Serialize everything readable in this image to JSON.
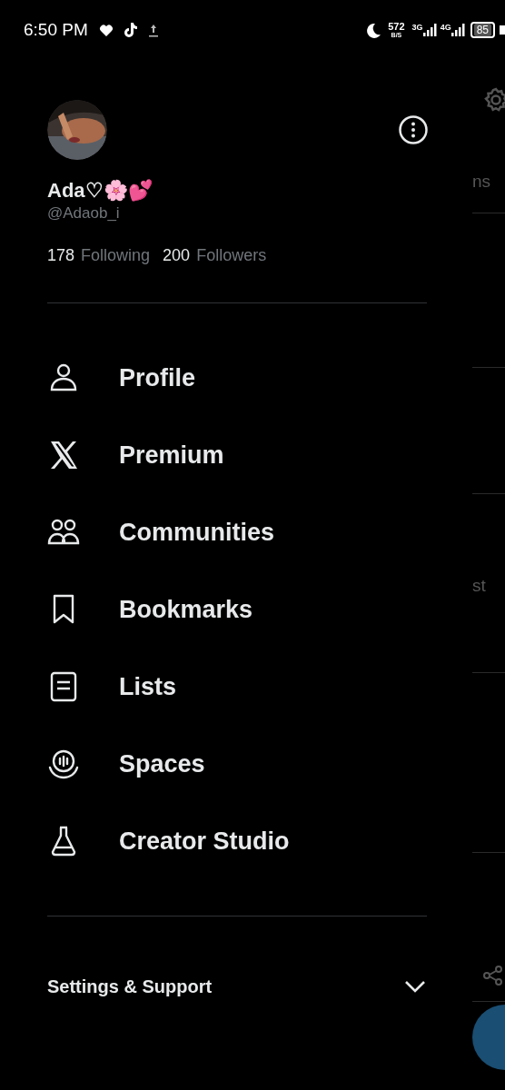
{
  "status_bar": {
    "time": "6:50 PM",
    "net_speed": "572",
    "net_unit": "B/S",
    "sim1": "3G",
    "sim2": "4G",
    "battery": "85"
  },
  "profile": {
    "name": "Ada♡🌸💕",
    "handle": "@Adaob_i",
    "following_count": "178",
    "following_label": "Following",
    "followers_count": "200",
    "followers_label": "Followers"
  },
  "menu": [
    {
      "label": "Profile",
      "kind": "person"
    },
    {
      "label": "Premium",
      "kind": "x"
    },
    {
      "label": "Communities",
      "kind": "people"
    },
    {
      "label": "Bookmarks",
      "kind": "bookmark"
    },
    {
      "label": "Lists",
      "kind": "list"
    },
    {
      "label": "Spaces",
      "kind": "spaces"
    },
    {
      "label": "Creator Studio",
      "kind": "flask"
    }
  ],
  "footer": {
    "label": "Settings & Support",
    "expanded": false
  },
  "background": {
    "fragment_1": "ns",
    "fragment_2": "st"
  }
}
